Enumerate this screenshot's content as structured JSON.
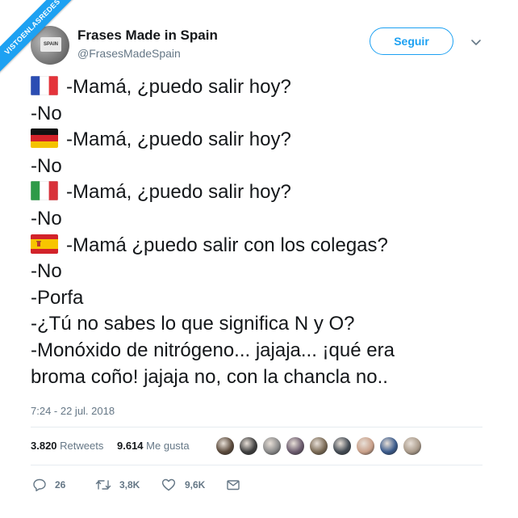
{
  "watermark": "VISTOENLASREDES",
  "user": {
    "name": "Frases Made in Spain",
    "handle": "@FrasesMadeSpain",
    "avatar_text": "SPAIN"
  },
  "follow_label": "Seguir",
  "lines": [
    {
      "flag": "france",
      "text": "-Mamá, ¿puedo salir hoy?"
    },
    {
      "text": "-No"
    },
    {
      "flag": "germany",
      "text": "-Mamá, ¿puedo salir hoy?"
    },
    {
      "text": "-No"
    },
    {
      "flag": "italy",
      "text": "-Mamá, ¿puedo salir hoy?"
    },
    {
      "text": "-No"
    },
    {
      "flag": "spain",
      "text": "-Mamá ¿puedo salir con los colegas?"
    },
    {
      "text": "-No"
    },
    {
      "text": "-Porfa"
    },
    {
      "text": "-¿Tú no sabes lo que significa N y O?"
    },
    {
      "text": "-Monóxido de nitrógeno... jajaja... ¡qué era"
    },
    {
      "text": "broma coño! jajaja no, con la chancla no.."
    }
  ],
  "timestamp": "7:24 - 22 jul. 2018",
  "stats": {
    "retweets_count": "3.820",
    "retweets_label": "Retweets",
    "likes_count": "9.614",
    "likes_label": "Me gusta"
  },
  "likers_colors": [
    "#5b4a3c",
    "#3f3f3f",
    "#8a8a8a",
    "#6b5b6e",
    "#7a6a55",
    "#444c55",
    "#c9a08a",
    "#3b5b8c",
    "#a99a8a"
  ],
  "actions": {
    "reply_count": "26",
    "retweet_count": "3,8K",
    "like_count": "9,6K"
  },
  "colors": {
    "accent": "#1da1f2",
    "text": "#14171a",
    "secondary": "#657786",
    "divider": "#e6ecf0"
  }
}
